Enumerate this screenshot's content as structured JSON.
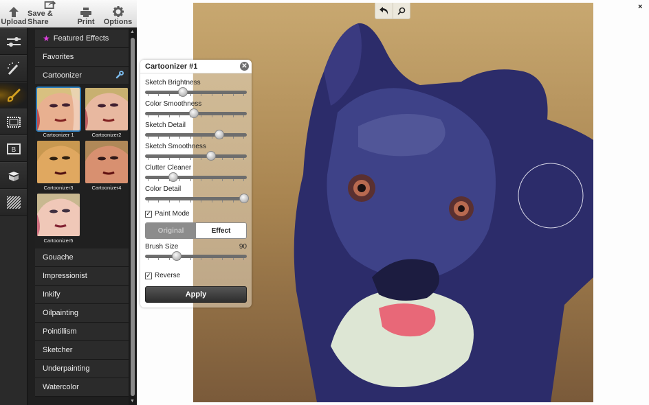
{
  "toolbar": {
    "upload": "Upload",
    "save_share": "Save & Share",
    "print": "Print",
    "options": "Options"
  },
  "rail": {
    "items": [
      {
        "icon": "adjustments-sliders-icon"
      },
      {
        "icon": "magic-wand-icon"
      },
      {
        "icon": "paintbrush-icon",
        "active": true
      },
      {
        "icon": "stamp-frame-icon"
      },
      {
        "icon": "border-b-icon"
      },
      {
        "icon": "box-package-icon"
      },
      {
        "icon": "texture-stripes-icon"
      }
    ],
    "active_color": "#d4a020"
  },
  "effects": {
    "featured": "Featured Effects",
    "favorites": "Favorites",
    "cartoonizer": "Cartoonizer",
    "presets": [
      {
        "label": "Cartoonizer 1",
        "selected": true
      },
      {
        "label": "Cartoonizer2"
      },
      {
        "label": "Cartoonizer3"
      },
      {
        "label": "Cartoonizer4"
      },
      {
        "label": "Cartoonizer5"
      }
    ],
    "items": [
      "Gouache",
      "Impressionist",
      "Inkify",
      "Oilpainting",
      "Pointillism",
      "Sketcher",
      "Underpainting",
      "Watercolor"
    ],
    "star_color": "#e040e0"
  },
  "dialog": {
    "title": "Cartoonizer #1",
    "sliders": [
      {
        "label": "Sketch Brightness",
        "value": 0.37
      },
      {
        "label": "Color Smoothness",
        "value": 0.48
      },
      {
        "label": "Sketch Detail",
        "value": 0.73
      },
      {
        "label": "Sketch Smoothness",
        "value": 0.65
      },
      {
        "label": "Clutter Cleaner",
        "value": 0.28
      },
      {
        "label": "Color Detail",
        "value": 0.97
      }
    ],
    "paint_mode": {
      "label": "Paint Mode",
      "checked": true
    },
    "toggle": {
      "original": "Original",
      "effect": "Effect",
      "selected": "Effect"
    },
    "brush_size": {
      "label": "Brush Size",
      "value": "90",
      "position": 0.31
    },
    "reverse": {
      "label": "Reverse",
      "checked": true
    },
    "apply": "Apply"
  },
  "canvas": {
    "undo": "undo-icon",
    "zoom": "zoom-icon",
    "close": "×"
  }
}
